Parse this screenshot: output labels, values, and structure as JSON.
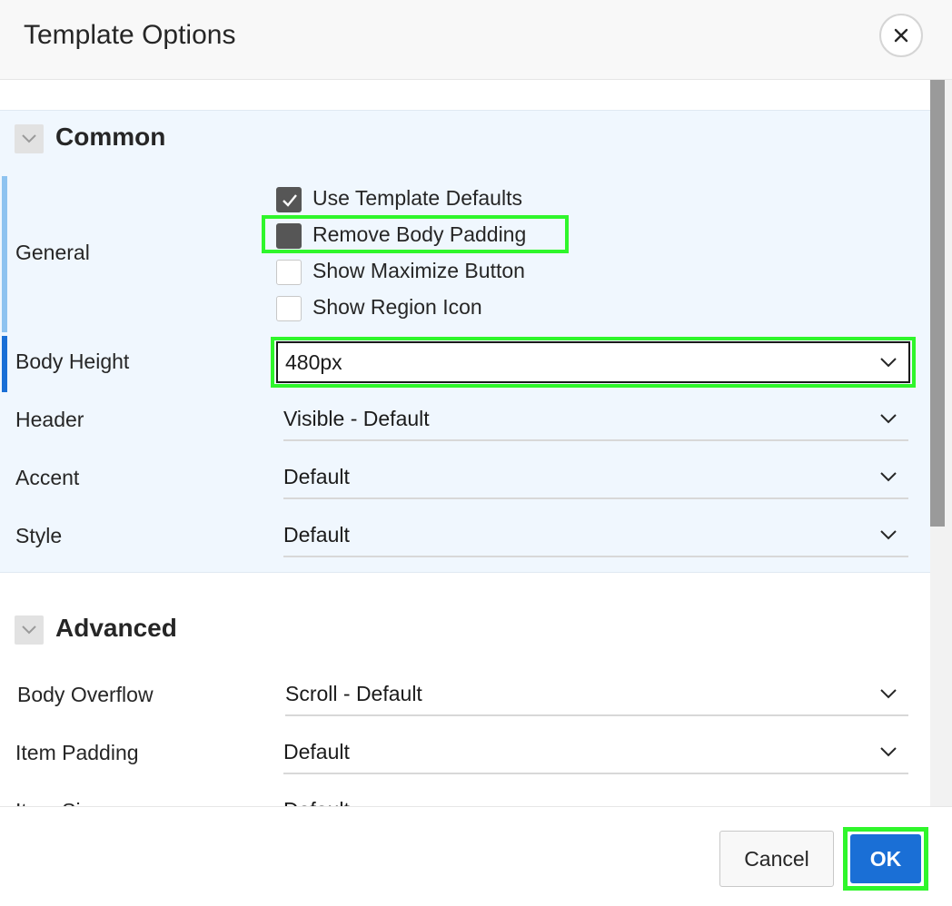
{
  "dialog": {
    "title": "Template Options"
  },
  "common": {
    "title": "Common",
    "general_label": "General",
    "checkboxes": [
      {
        "label": "Use Template Defaults",
        "checked": true
      },
      {
        "label": "Remove Body Padding",
        "checked": false
      },
      {
        "label": "Show Maximize Button",
        "checked": false
      },
      {
        "label": "Show Region Icon",
        "checked": false
      }
    ],
    "body_height": {
      "label": "Body Height",
      "value": "480px"
    },
    "header": {
      "label": "Header",
      "value": "Visible - Default"
    },
    "accent": {
      "label": "Accent",
      "value": "Default"
    },
    "style": {
      "label": "Style",
      "value": "Default"
    }
  },
  "advanced": {
    "title": "Advanced",
    "body_overflow": {
      "label": "Body Overflow",
      "value": "Scroll - Default"
    },
    "item_padding": {
      "label": "Item Padding",
      "value": "Default"
    },
    "item_size": {
      "label": "Item Size",
      "value": "Default"
    }
  },
  "footer": {
    "cancel_label": "Cancel",
    "ok_label": "OK"
  },
  "colors": {
    "highlight": "#2ff62b",
    "primary_button": "#1a6fd6",
    "section_bg": "#f0f7fe",
    "general_bar": "#8ec3f0",
    "body_height_bar": "#1a6fd6"
  },
  "icons": {
    "close": "close-icon",
    "collapse": "chevron-down-icon",
    "select": "chevron-down-icon",
    "checkbox_check": "check-icon"
  }
}
